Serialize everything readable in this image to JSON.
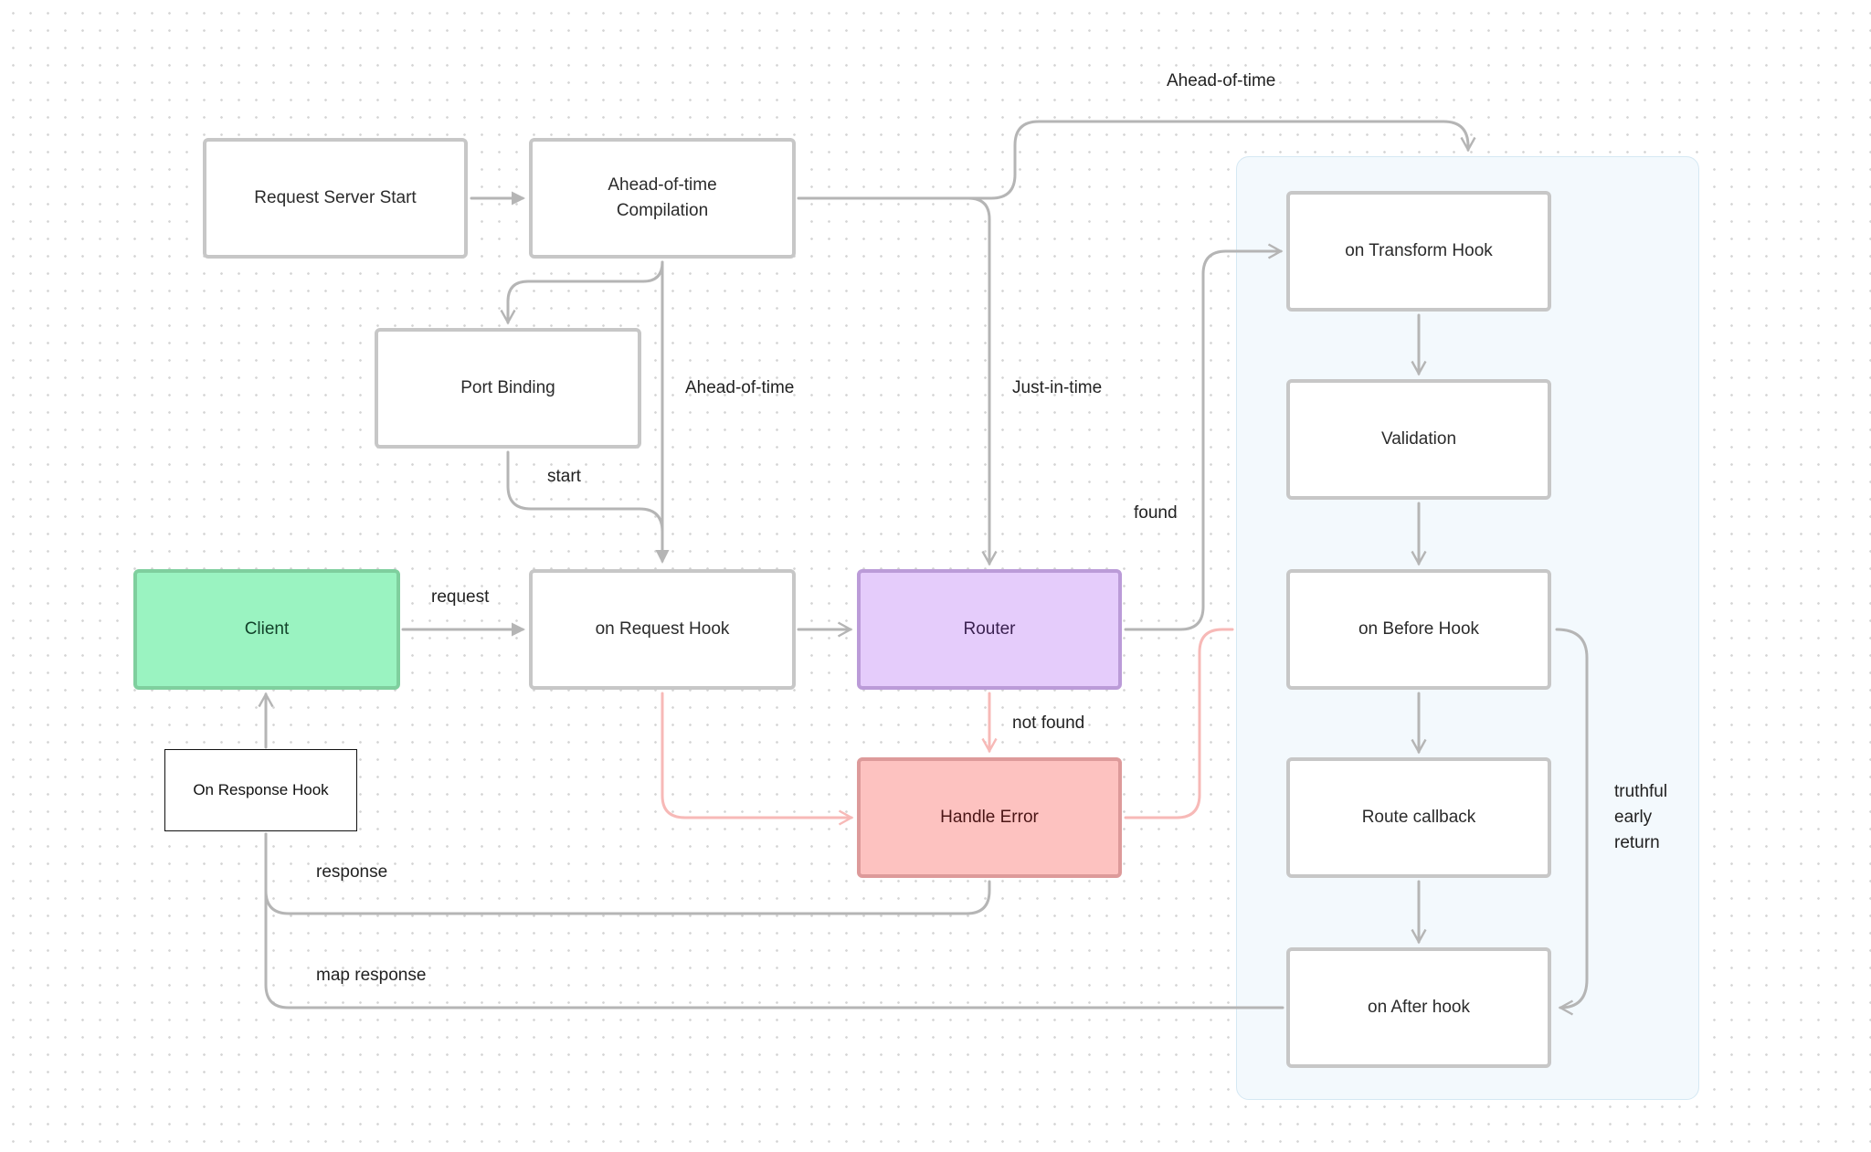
{
  "colors": {
    "edge": "#b5b5b5",
    "error_edge": "#f7b9b7",
    "client_fill": "#9af3c1",
    "router_fill": "#e5ccfb",
    "error_fill": "#fdc2c0",
    "group_fill": "#f3f9fd"
  },
  "nodes": {
    "request_server_start": "Request Server Start",
    "aot_compilation": "Ahead-of-time\nCompilation",
    "port_binding": "Port Binding",
    "client": "Client",
    "on_request_hook": "on Request Hook",
    "router": "Router",
    "handle_error": "Handle Error",
    "on_response_hook": "On Response Hook",
    "on_transform_hook": "on Transform Hook",
    "validation": "Validation",
    "on_before_hook": "on Before Hook",
    "route_callback": "Route callback",
    "on_after_hook": "on After hook"
  },
  "edge_labels": {
    "aot_top": "Ahead-of-time",
    "aot_middle": "Ahead-of-time",
    "jit": "Just-in-time",
    "start": "start",
    "found": "found",
    "request": "request",
    "not_found": "not found",
    "response": "response",
    "map_response": "map response",
    "truthful_early_return": "truthful\nearly\nreturn"
  }
}
